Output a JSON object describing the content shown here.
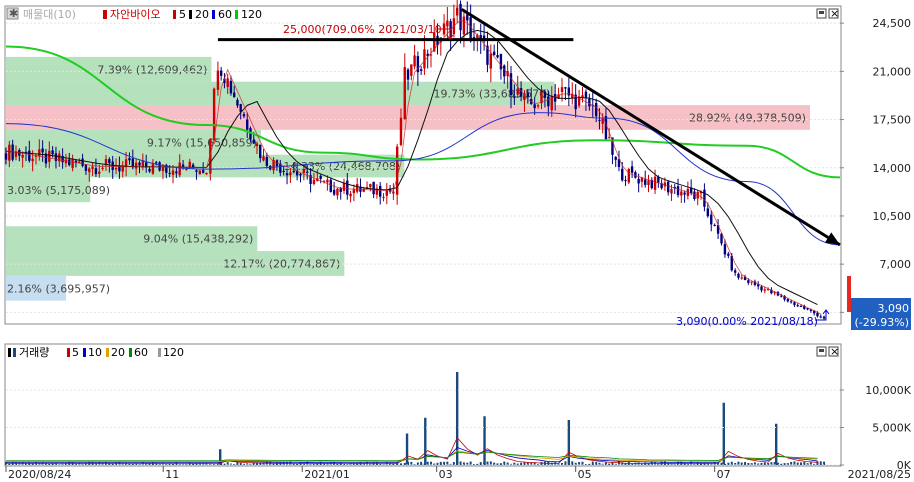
{
  "price_panel": {
    "legend": {
      "icon": "gear-icon",
      "main_label": "매물대(10)",
      "stock_label": "자안바이오",
      "ma_items": [
        {
          "label": "5",
          "color": "#cc0000"
        },
        {
          "label": "20",
          "color": "#000000"
        },
        {
          "label": "60",
          "color": "#0000cc"
        },
        {
          "label": "120",
          "color": "#00cc00"
        }
      ]
    },
    "high_annotation": "25,000(709.06% 2021/03/10)",
    "low_annotation": "3,090(0.00% 2021/08/18)",
    "current_price": "3,090",
    "current_change": "(-29.93%)",
    "y_ticks": [
      "24,500",
      "21,000",
      "17,500",
      "14,000",
      "10,500",
      "7,000",
      "3,500"
    ],
    "volume_profile": [
      {
        "label": "7.39% (12,609,462)",
        "price_low": 20250,
        "price_high": 22050,
        "pct": 7.39,
        "color": "#a8dcb0"
      },
      {
        "label": "28.92% (49,378,509)",
        "price_low": 16750,
        "price_high": 18550,
        "pct": 28.92,
        "color": "#f4b6bc"
      },
      {
        "label": "19.73% (33,683,570)",
        "price_low": 18550,
        "price_high": 20250,
        "pct": 19.73,
        "color": "#a8dcb0"
      },
      {
        "label": "9.17% (15,650,859)",
        "price_low": 14950,
        "price_high": 16750,
        "pct": 9.17,
        "color": "#a8dcb0"
      },
      {
        "label": "14.33% (24,468,708)",
        "price_low": 13300,
        "price_high": 14950,
        "pct": 14.33,
        "color": "#a8dcb0"
      },
      {
        "label": "3.03% (5,175,089)",
        "price_low": 11500,
        "price_high": 13300,
        "pct": 3.03,
        "color": "#a8dcb0"
      },
      {
        "label": "9.04% (15,438,292)",
        "price_low": 7950,
        "price_high": 9750,
        "pct": 9.04,
        "color": "#a8dcb0"
      },
      {
        "label": "12.17% (20,774,867)",
        "price_low": 6150,
        "price_high": 7950,
        "pct": 12.17,
        "color": "#a8dcb0"
      },
      {
        "label": "2.16% (3,695,957)",
        "price_low": 4350,
        "price_high": 6150,
        "pct": 2.16,
        "color": "#bcd8ee"
      }
    ]
  },
  "volume_panel": {
    "legend": {
      "main_label": "거래량",
      "ma_items": [
        {
          "label": "5",
          "color": "#cc0000"
        },
        {
          "label": "10",
          "color": "#0000cc"
        },
        {
          "label": "20",
          "color": "#e0a000"
        },
        {
          "label": "60",
          "color": "#008800"
        },
        {
          "label": "120",
          "color": "#999999"
        }
      ]
    },
    "y_ticks": [
      "10,000K",
      "5,000K",
      "0K"
    ]
  },
  "x_axis": {
    "ticks": [
      "2020/08/24",
      "11",
      "2021/01",
      "03",
      "05",
      "07",
      "2021/08/25"
    ]
  },
  "colors": {
    "up": "#cc0000",
    "down": "#000080",
    "vol_bar": "#1a4a7a",
    "accent_up_box": "#e8281e",
    "accent_down_box": "#2060c0"
  },
  "chart_data": {
    "type": "candlestick",
    "x_start": "2020/08/24",
    "x_end": "2021/08/25",
    "ylim": [
      2800,
      25600
    ],
    "key_points": [
      {
        "date": "2020/08/24",
        "price": 15200
      },
      {
        "date": "2020/10/01",
        "price": 14100
      },
      {
        "date": "2020/11/20",
        "price": 14000
      },
      {
        "date": "2020/11/25",
        "price": 21900
      },
      {
        "date": "2020/12/15",
        "price": 14600
      },
      {
        "date": "2021/01/15",
        "price": 12500
      },
      {
        "date": "2021/02/10",
        "price": 12300
      },
      {
        "date": "2021/02/15",
        "price": 20500
      },
      {
        "date": "2021/03/10",
        "price": 25000
      },
      {
        "date": "2021/04/10",
        "price": 18500
      },
      {
        "date": "2021/04/25",
        "price": 19500
      },
      {
        "date": "2021/05/10",
        "price": 18200
      },
      {
        "date": "2021/05/20",
        "price": 13700
      },
      {
        "date": "2021/06/25",
        "price": 11800
      },
      {
        "date": "2021/07/10",
        "price": 6200
      },
      {
        "date": "2021/08/18",
        "price": 3090
      }
    ],
    "ma120_points": [
      {
        "date": "2020/08/24",
        "price": 22800
      },
      {
        "date": "2020/11/20",
        "price": 17100
      },
      {
        "date": "2021/01/10",
        "price": 15100
      },
      {
        "date": "2021/02/20",
        "price": 14600
      },
      {
        "date": "2021/05/10",
        "price": 16000
      },
      {
        "date": "2021/07/15",
        "price": 15600
      },
      {
        "date": "2021/08/25",
        "price": 13300
      }
    ],
    "ma60_points": [
      {
        "date": "2020/08/24",
        "price": 17200
      },
      {
        "date": "2020/11/20",
        "price": 13900
      },
      {
        "date": "2021/02/10",
        "price": 14500
      },
      {
        "date": "2021/04/15",
        "price": 18000
      },
      {
        "date": "2021/05/15",
        "price": 17600
      },
      {
        "date": "2021/07/15",
        "price": 13000
      },
      {
        "date": "2021/08/25",
        "price": 8400
      }
    ],
    "trend_lines": [
      {
        "from": {
          "date": "2020/11/25",
          "price": 23300
        },
        "to": {
          "date": "2021/04/30",
          "price": 23300
        }
      },
      {
        "from": {
          "date": "2021/03/12",
          "price": 25500
        },
        "to": {
          "date": "2021/08/25",
          "price": 8400
        }
      }
    ],
    "volume_spikes": [
      {
        "date": "2020/11/26",
        "volume": 2100
      },
      {
        "date": "2021/02/16",
        "volume": 4200
      },
      {
        "date": "2021/02/24",
        "volume": 6300
      },
      {
        "date": "2021/03/10",
        "volume": 12400
      },
      {
        "date": "2021/03/22",
        "volume": 6500
      },
      {
        "date": "2021/04/28",
        "volume": 6000
      },
      {
        "date": "2021/07/05",
        "volume": 8300
      },
      {
        "date": "2021/07/28",
        "volume": 5500
      }
    ]
  }
}
